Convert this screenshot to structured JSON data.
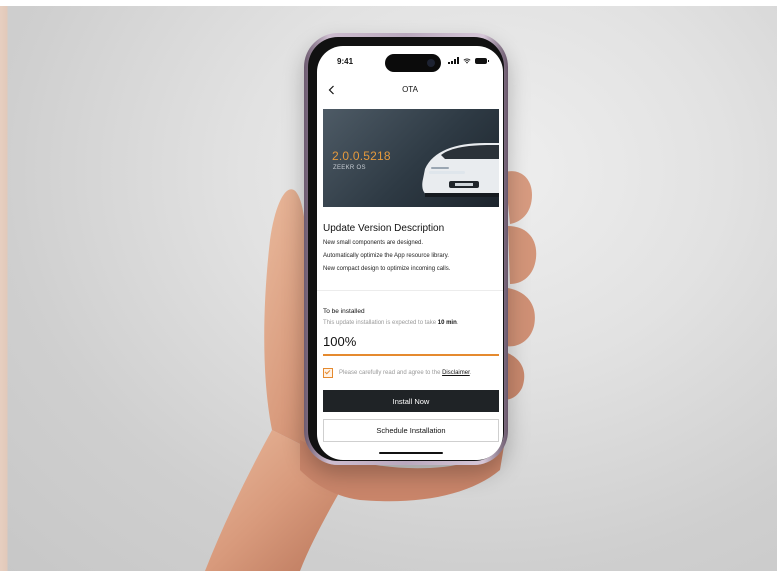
{
  "status_bar": {
    "time": "9:41"
  },
  "nav": {
    "title": "OTA",
    "back_icon": "chevron-left-icon"
  },
  "hero": {
    "version": "2.0.0.5218",
    "os_name": "ZEEKR OS"
  },
  "description": {
    "title": "Update Version Description",
    "lines": [
      "New small components are designed.",
      "Automatically optimize the App resource library.",
      "New compact design to optimize incoming calls."
    ]
  },
  "install": {
    "status_label": "To be installed",
    "expect_prefix": "This update installation is expected to take ",
    "expect_time": "10 min",
    "expect_suffix": ".",
    "percent": "100%",
    "progress_fraction": 1.0
  },
  "agreement": {
    "checked": true,
    "text": "Please carefully read and agree to the ",
    "link": "Disclaimer",
    "suffix": "."
  },
  "buttons": {
    "install_now": "Install Now",
    "schedule": "Schedule Installation"
  },
  "colors": {
    "accent": "#e58a2f",
    "primary_button": "#1f2326",
    "version_text": "#e59a3d"
  }
}
